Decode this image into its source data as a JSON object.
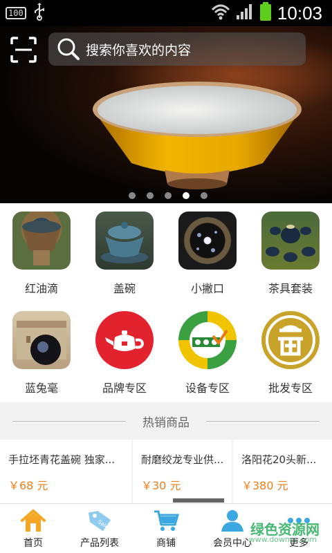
{
  "status_bar": {
    "battery_badge": "100",
    "time": "10:03"
  },
  "search": {
    "placeholder": "搜索你喜欢的内容"
  },
  "banner": {
    "active_slide": 4,
    "slide_count": 5
  },
  "categories": [
    {
      "label": "红油滴",
      "icon": "teabowl-photo-1"
    },
    {
      "label": "盖碗",
      "icon": "gaiwan-photo"
    },
    {
      "label": "小撇口",
      "icon": "tenmoku-bowl-photo"
    },
    {
      "label": "茶具套装",
      "icon": "tea-set-photo"
    },
    {
      "label": "蓝兔毫",
      "icon": "boxed-bowl-photo"
    },
    {
      "label": "品牌专区",
      "icon": "teapot-icon"
    },
    {
      "label": "设备专区",
      "icon": "equipment-logo-icon"
    },
    {
      "label": "批发专区",
      "icon": "wholesale-logo-icon"
    }
  ],
  "hot": {
    "title": "热销商品",
    "products": [
      {
        "name": "手拉坯青花盖碗 独家...",
        "price": "￥68 元"
      },
      {
        "name": "耐磨绞龙专业供...",
        "price": "￥30 元"
      },
      {
        "name": "洛阳花20头新...",
        "price": "￥380 元"
      }
    ]
  },
  "nav": [
    {
      "label": "首页",
      "icon": "home-icon"
    },
    {
      "label": "产品列表",
      "icon": "sale-tag-icon"
    },
    {
      "label": "商铺",
      "icon": "cart-icon"
    },
    {
      "label": "会员中心",
      "icon": "user-icon"
    },
    {
      "label": "更多",
      "icon": "more-icon"
    }
  ],
  "watermark": {
    "text": "绿色资源网",
    "sub": "www.downcc.com"
  },
  "colors": {
    "accent_orange": "#f08020",
    "nav_icon": "#3aa7e0",
    "home_icon": "#f5a623"
  }
}
